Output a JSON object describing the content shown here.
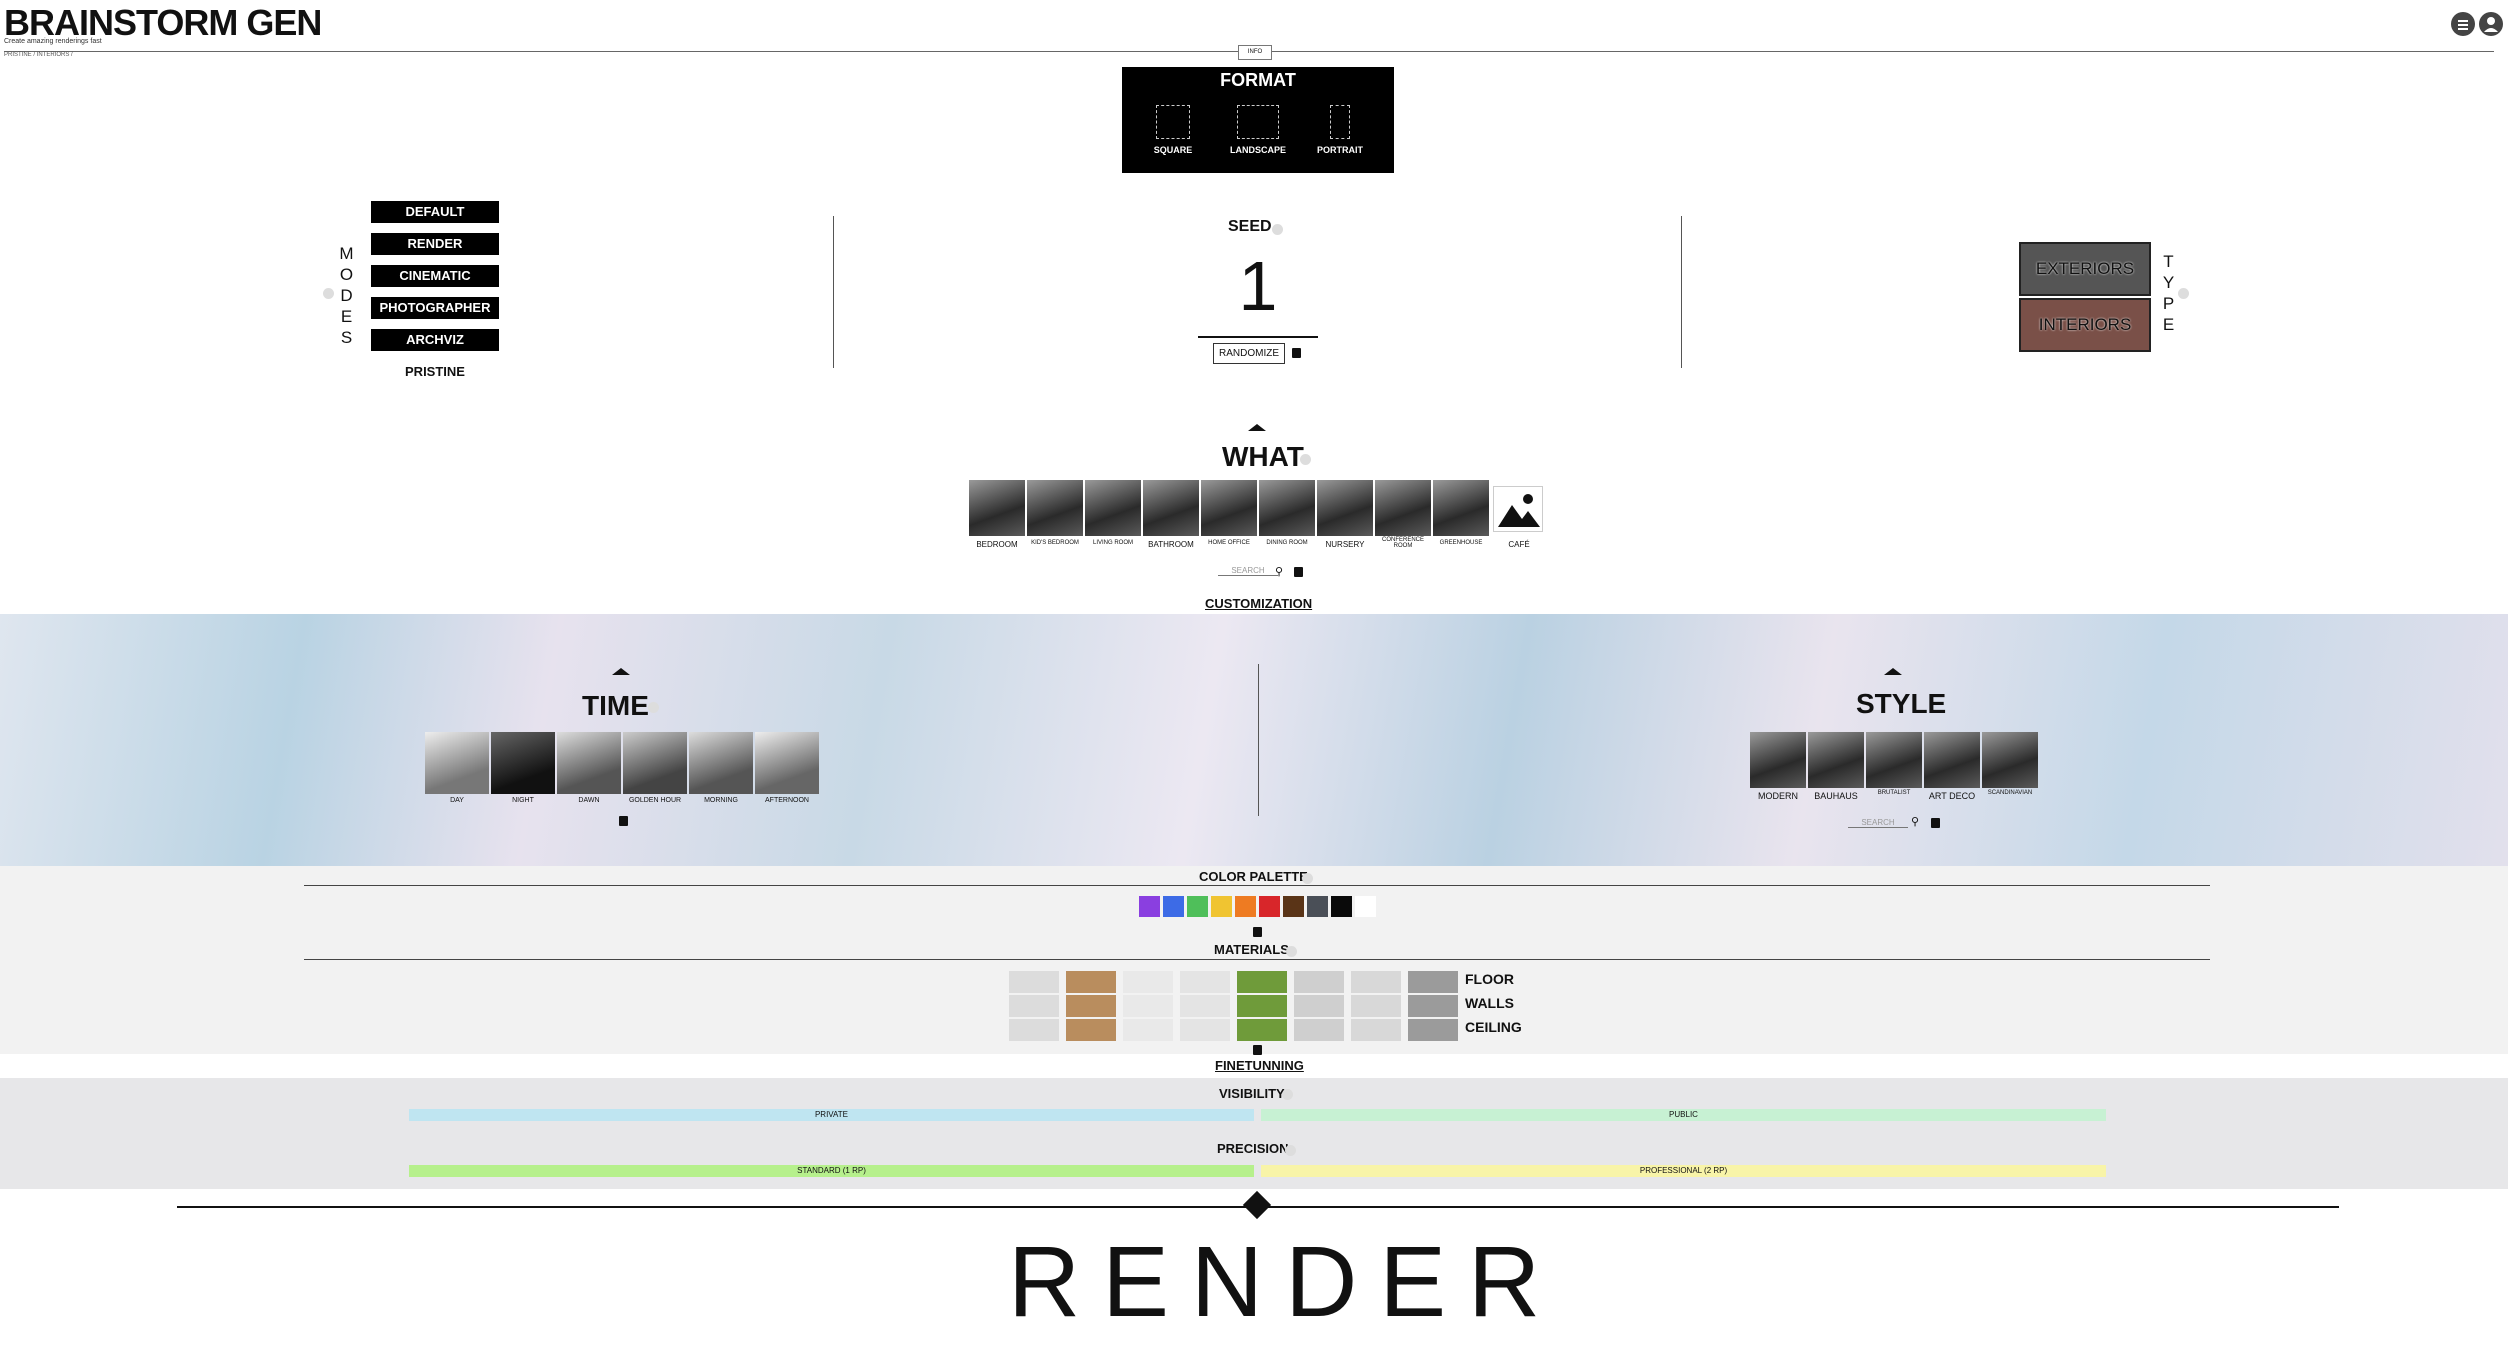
{
  "header": {
    "title": "BRAINSTORM GEN",
    "subtitle": "Create amazing renderings fast",
    "breadcrumb": "PRISTINE / INTERIORS /",
    "info_label": "INFO",
    "icons": [
      "menu-icon",
      "user-icon"
    ]
  },
  "format": {
    "title": "FORMAT",
    "options": [
      "SQUARE",
      "LANDSCAPE",
      "PORTRAIT"
    ]
  },
  "modes": {
    "vertical_label": "MODES",
    "items": [
      "DEFAULT",
      "RENDER",
      "CINEMATIC",
      "PHOTOGRAPHER",
      "ARCHVIZ"
    ],
    "selected": "PRISTINE"
  },
  "seed": {
    "label": "SEED",
    "value": "1",
    "randomize_label": "RANDOMIZE"
  },
  "type": {
    "vertical_label": "TYPE",
    "items": [
      "EXTERIORS",
      "INTERIORS"
    ],
    "selected": "INTERIORS"
  },
  "what": {
    "title": "WHAT",
    "items": [
      "BEDROOM",
      "KID'S BEDROOM",
      "LIVING ROOM",
      "BATHROOM",
      "HOME OFFICE",
      "DINING ROOM",
      "NURSERY",
      "CONFERENCE ROOM",
      "GREENHOUSE",
      "CAFÉ"
    ],
    "search_placeholder": "SEARCH",
    "customization_link": "CUSTOMIZATION"
  },
  "time": {
    "title": "TIME",
    "items": [
      "DAY",
      "NIGHT",
      "DAWN",
      "GOLDEN HOUR",
      "MORNING",
      "AFTERNOON"
    ]
  },
  "style": {
    "title": "STYLE",
    "items": [
      "MODERN",
      "BAUHAUS",
      "BRUTALIST",
      "ART DECO",
      "SCANDINAVIAN"
    ],
    "search_placeholder": "SEARCH"
  },
  "color_palette": {
    "title": "COLOR PALETTE",
    "colors": [
      "#8a3fe0",
      "#3d6be6",
      "#4fbf5a",
      "#f0c431",
      "#ee7b22",
      "#d8262a",
      "#5a3417",
      "#4a4f57",
      "#0a0a0a",
      "#ffffff"
    ]
  },
  "materials": {
    "title": "MATERIALS",
    "rows": [
      "FLOOR",
      "WALLS",
      "CEILING"
    ],
    "swatches": [
      "#dcdcdc",
      "#b98d5e",
      "#e9e9e9",
      "#e4e4e4",
      "#6f9b3a",
      "#cfcfcf",
      "#d8d8d8",
      "#9b9b9b"
    ],
    "finetuning_link": "FINETUNNING"
  },
  "visibility": {
    "title": "VISIBILITY",
    "options": [
      "PRIVATE",
      "PUBLIC"
    ],
    "colors": [
      "#bfe5f1",
      "#c7f1d3"
    ]
  },
  "precision": {
    "title": "PRECISION",
    "options": [
      "STANDARD (1 RP)",
      "PROFESSIONAL (2 RP)"
    ],
    "colors": [
      "#b6f08c",
      "#f8f4a8"
    ]
  },
  "render_label": "RENDER"
}
